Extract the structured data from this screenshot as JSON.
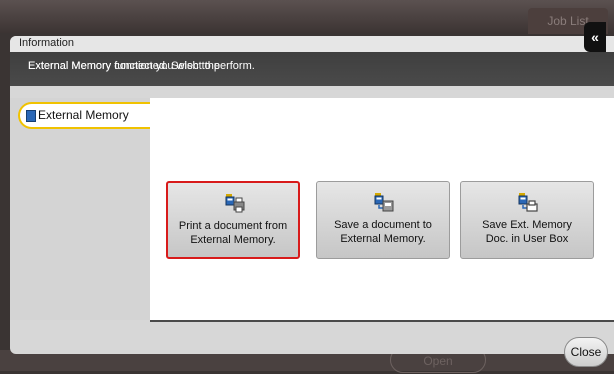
{
  "header": {
    "job_list_label": "Job List"
  },
  "background": {
    "open_label": "Open"
  },
  "dialog": {
    "title": "Information",
    "message_line1": "External Memory connected. Select the",
    "message_line2": "External Memory function you wish to perform.",
    "back_icon": "double-chevron-left-icon"
  },
  "sidebar": {
    "tabs": [
      {
        "label": "External Memory",
        "icon": "memory-card-icon",
        "selected": true
      }
    ]
  },
  "functions": [
    {
      "line1": "Print a document from",
      "line2": "External Memory.",
      "icon": "print-from-memory-icon",
      "selected": true
    },
    {
      "line1": "Save a document to",
      "line2": "External Memory.",
      "icon": "save-to-memory-icon",
      "selected": false
    },
    {
      "line1": "Save Ext. Memory",
      "line2": "Doc. in User Box",
      "icon": "save-to-userbox-icon",
      "selected": false
    }
  ],
  "footer": {
    "close_label": "Close"
  },
  "colors": {
    "selection_border": "#d81b1b",
    "tab_highlight": "#f0c200",
    "message_bar": "#444444"
  }
}
